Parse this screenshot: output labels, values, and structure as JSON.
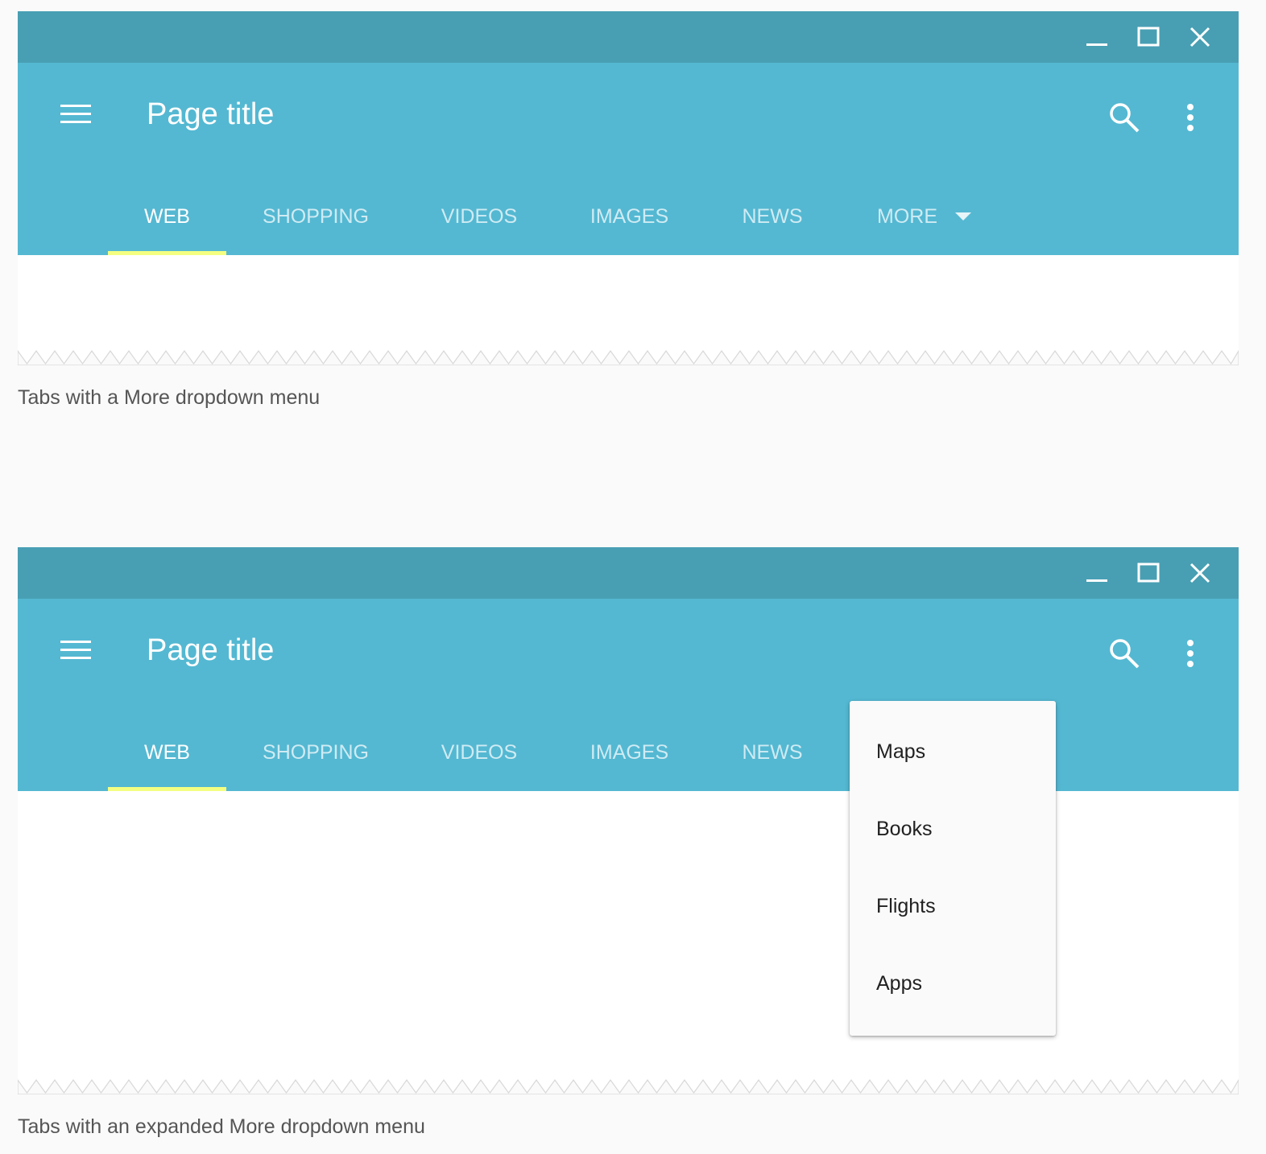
{
  "examples": [
    {
      "page_title": "Page title",
      "tabs": [
        "WEB",
        "SHOPPING",
        "VIDEOS",
        "IMAGES",
        "NEWS"
      ],
      "more_label": "MORE",
      "caption": "Tabs with a More dropdown menu"
    },
    {
      "page_title": "Page title",
      "tabs": [
        "WEB",
        "SHOPPING",
        "VIDEOS",
        "IMAGES",
        "NEWS"
      ],
      "dropdown_items": [
        "Maps",
        "Books",
        "Flights",
        "Apps"
      ],
      "caption": "Tabs with an expanded More dropdown menu"
    }
  ],
  "colors": {
    "titlebar": "#489fb3",
    "appbar": "#54b8d2",
    "tab_indicator": "#f4ff81"
  },
  "icons": [
    "minimize-icon",
    "maximize-icon",
    "close-icon",
    "menu-icon",
    "search-icon",
    "more-vert-icon",
    "dropdown-arrow-icon"
  ]
}
